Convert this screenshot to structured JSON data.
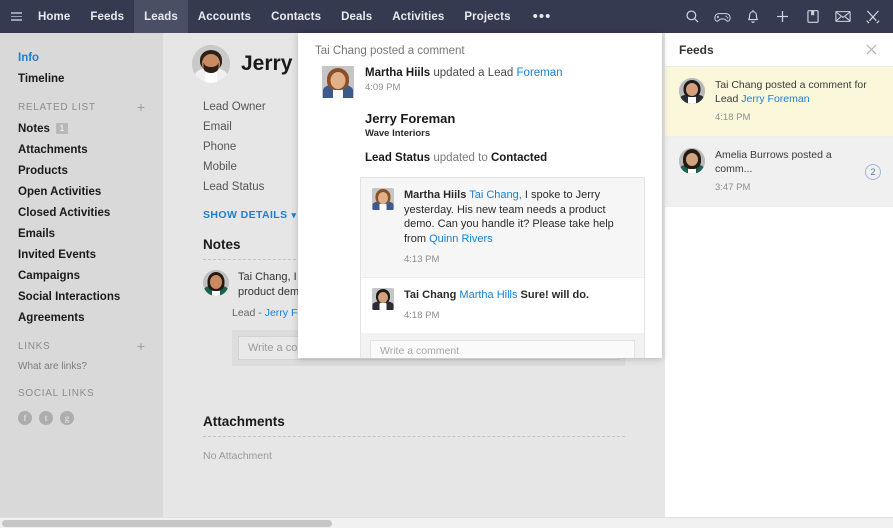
{
  "theme": {
    "nav_bg": "#353a50",
    "nav_active_bg": "#4a4f66",
    "sidebar_bg": "#d9d9d9",
    "main_bg": "#e6e6e6",
    "accent_link": "#1a7fd4",
    "feed_highlight_bg": "#fbf7db"
  },
  "topnav": {
    "menu_icon": "hamburger-icon",
    "items": [
      {
        "label": "Home",
        "active": false
      },
      {
        "label": "Feeds",
        "active": false
      },
      {
        "label": "Leads",
        "active": true
      },
      {
        "label": "Accounts",
        "active": false
      },
      {
        "label": "Contacts",
        "active": false
      },
      {
        "label": "Deals",
        "active": false
      },
      {
        "label": "Activities",
        "active": false
      },
      {
        "label": "Projects",
        "active": false
      }
    ],
    "more_label": "•••",
    "icons": [
      "search-icon",
      "gamepad-icon",
      "bell-icon",
      "plus-icon",
      "notes-icon",
      "mail-icon",
      "tools-icon"
    ]
  },
  "sidebar": {
    "top_items": [
      {
        "label": "Info",
        "selected": true
      },
      {
        "label": "Timeline",
        "selected": false
      }
    ],
    "related_list": {
      "title": "RELATED LIST",
      "add_label": "+",
      "items": [
        {
          "label": "Notes",
          "badge": "1"
        },
        {
          "label": "Attachments",
          "badge": ""
        },
        {
          "label": "Products",
          "badge": ""
        },
        {
          "label": "Open Activities",
          "badge": ""
        },
        {
          "label": "Closed Activities",
          "badge": ""
        },
        {
          "label": "Emails",
          "badge": ""
        },
        {
          "label": "Invited Events",
          "badge": ""
        },
        {
          "label": "Campaigns",
          "badge": ""
        },
        {
          "label": "Social Interactions",
          "badge": ""
        },
        {
          "label": "Agreements",
          "badge": ""
        }
      ]
    },
    "links": {
      "title": "LINKS",
      "add_label": "+",
      "help_text": "What are links?"
    },
    "social_links": {
      "title": "SOCIAL LINKS",
      "items": [
        "f",
        "t",
        "g"
      ]
    }
  },
  "main": {
    "record": {
      "name": "Jerry Foreman",
      "avatar": "male-avatar"
    },
    "fields": [
      "Lead Owner",
      "Email",
      "Phone",
      "Mobile",
      "Lead Status"
    ],
    "show_details_label": "SHOW DETAILS",
    "notes": {
      "title": "Notes",
      "entry_text": "Tai Chang, I spoke to Jerry yesterday. His new team needs a product demo. Can you handle it?",
      "lead_prefix": "Lead - ",
      "lead_link": "Jerry Foreman",
      "comment_placeholder": "Write a comment"
    },
    "attachments": {
      "title": "Attachments",
      "empty_text": "No Attachment"
    }
  },
  "feeds_panel": {
    "title": "Feeds",
    "close_icon": "close-icon",
    "items": [
      {
        "text_before": "Tai Chang posted a comment for Lead ",
        "link": "Jerry Foreman",
        "time": "4:18 PM",
        "count": "",
        "avatar": "male-avatar-dark"
      },
      {
        "text_before": "Amelia Burrows posted a comm...",
        "link": "",
        "time": "3:47 PM",
        "count": "2",
        "avatar": "female-avatar-dark"
      }
    ]
  },
  "popup": {
    "header_text": "Tai Chang posted a comment",
    "author": "Martha Hiils",
    "action_text": " updated a Lead ",
    "lead_link": "Foreman",
    "time": "4:09 PM",
    "lead_name": "Jerry Foreman",
    "company": "Wave Interiors",
    "status_field": "Lead Status",
    "status_mid": " updated to ",
    "status_value": "Contacted",
    "comments": [
      {
        "author": "Martha Hiils",
        "mention": "Tai Chang,",
        "text": " I spoke to Jerry yesterday. His new team needs a product demo. Can you handle it? Please take help from ",
        "mention2": "Quinn Rivers",
        "time": "4:13 PM",
        "avatar": "female-avatar"
      },
      {
        "author": "Tai Chang",
        "mention": "Martha Hills",
        "text": " Sure! will do.",
        "mention2": "",
        "time": "4:18 PM",
        "avatar": "male-avatar-dark"
      }
    ],
    "comment_placeholder": "Write a comment"
  }
}
